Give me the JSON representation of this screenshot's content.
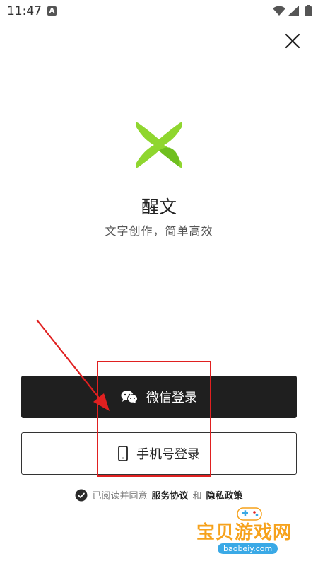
{
  "status_bar": {
    "time": "11:47",
    "notification_letter": "A",
    "icons": [
      "wifi-icon",
      "signal-icon",
      "battery-icon"
    ]
  },
  "header": {
    "close_icon": "close-icon"
  },
  "app": {
    "name": "醒文",
    "tagline": "文字创作，简单高效",
    "logo_color": "#8fd62f"
  },
  "buttons": {
    "wechat_label": "微信登录",
    "wechat_icon": "wechat-icon",
    "phone_label": "手机号登录",
    "phone_icon": "phone-icon"
  },
  "agreement": {
    "prefix": "已阅读并同意",
    "service_link": "服务协议",
    "and": "和",
    "privacy_link": "隐私政策",
    "checked": true
  },
  "watermark": {
    "text": "宝贝游戏网",
    "url": "baobeiy.com"
  },
  "colors": {
    "primary_button": "#1f1f1f",
    "annotation": "#e02020"
  }
}
